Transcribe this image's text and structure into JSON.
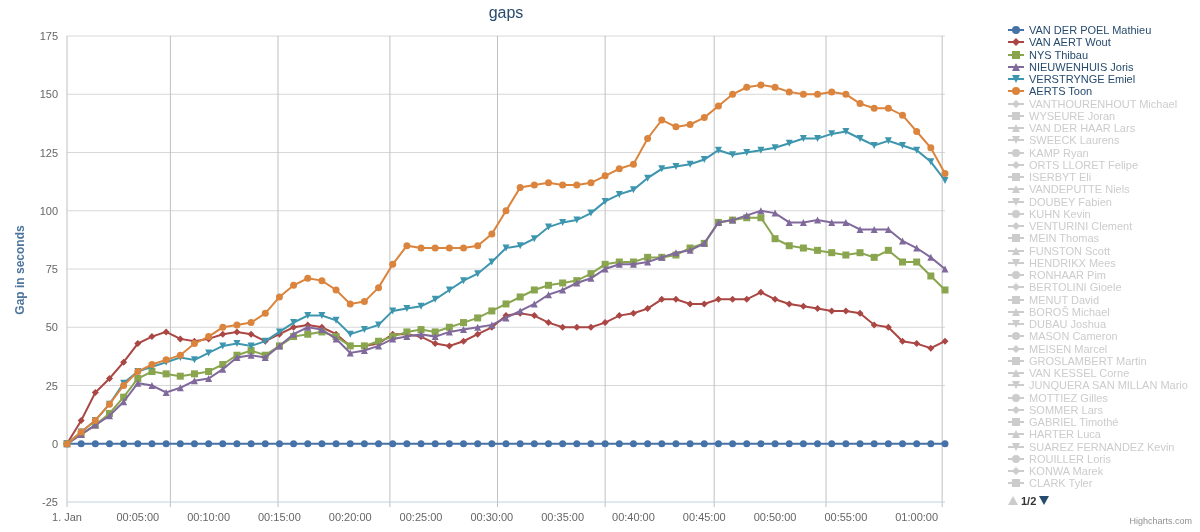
{
  "chart": {
    "chart_data": {
      "type": "line",
      "grid": true,
      "title": "gaps",
      "ylabel": "Gap in seconds",
      "x": [
        0,
        1,
        2,
        3,
        4,
        5,
        6,
        7,
        8,
        9,
        10,
        11,
        12,
        13,
        14,
        15,
        16,
        17,
        18,
        19,
        20,
        21,
        22,
        23,
        24,
        25,
        26,
        27,
        28,
        29,
        30,
        31,
        32,
        33,
        34,
        35,
        36,
        37,
        38,
        39,
        40,
        41,
        42,
        43,
        44,
        45,
        46,
        47,
        48,
        49,
        50,
        51,
        52,
        53,
        54,
        55,
        56,
        57,
        58,
        59,
        60,
        61,
        62
      ],
      "xlim": [
        0,
        62
      ],
      "ylim": [
        -25,
        175
      ],
      "yticks": [
        -25,
        0,
        25,
        50,
        75,
        100,
        125,
        150,
        175
      ],
      "xticks": [
        {
          "value": 0,
          "label": "1. Jan"
        },
        {
          "value": 5,
          "label": "00:05:00"
        },
        {
          "value": 10,
          "label": "00:10:00"
        },
        {
          "value": 15,
          "label": "00:15:00"
        },
        {
          "value": 20,
          "label": "00:20:00"
        },
        {
          "value": 25,
          "label": "00:25:00"
        },
        {
          "value": 30,
          "label": "00:30:00"
        },
        {
          "value": 35,
          "label": "00:35:00"
        },
        {
          "value": 40,
          "label": "00:40:00"
        },
        {
          "value": 45,
          "label": "00:45:00"
        },
        {
          "value": 50,
          "label": "00:50:00"
        },
        {
          "value": 55,
          "label": "00:55:00"
        },
        {
          "value": 60,
          "label": "01:00:00"
        }
      ],
      "series": [
        {
          "name": "VAN DER POEL Mathieu",
          "color": "#4572a7",
          "marker": "circle",
          "values": [
            0,
            0,
            0,
            0,
            0,
            0,
            0,
            0,
            0,
            0,
            0,
            0,
            0,
            0,
            0,
            0,
            0,
            0,
            0,
            0,
            0,
            0,
            0,
            0,
            0,
            0,
            0,
            0,
            0,
            0,
            0,
            0,
            0,
            0,
            0,
            0,
            0,
            0,
            0,
            0,
            0,
            0,
            0,
            0,
            0,
            0,
            0,
            0,
            0,
            0,
            0,
            0,
            0,
            0,
            0,
            0,
            0,
            0,
            0,
            0,
            0,
            0,
            0
          ]
        },
        {
          "name": "VAN AERT Wout",
          "color": "#aa4643",
          "marker": "diamond",
          "values": [
            0,
            10,
            22,
            28,
            35,
            43,
            46,
            48,
            45,
            44,
            45,
            47,
            48,
            47,
            44,
            47,
            50,
            51,
            50,
            47,
            42,
            42,
            43,
            47,
            47,
            46,
            43,
            42,
            44,
            47,
            50,
            55,
            56,
            55,
            52,
            50,
            50,
            50,
            52,
            55,
            56,
            58,
            62,
            62,
            60,
            60,
            62,
            62,
            62,
            65,
            62,
            60,
            59,
            58,
            57,
            57,
            56,
            51,
            50,
            44,
            43,
            41,
            44
          ]
        },
        {
          "name": "NYS Thibau",
          "color": "#89a54e",
          "marker": "square",
          "values": [
            0,
            4,
            8,
            13,
            20,
            28,
            31,
            30,
            29,
            30,
            31,
            34,
            38,
            40,
            38,
            42,
            46,
            47,
            48,
            46,
            42,
            42,
            44,
            46,
            48,
            49,
            48,
            50,
            52,
            54,
            57,
            60,
            63,
            66,
            68,
            69,
            70,
            73,
            77,
            78,
            78,
            80,
            80,
            81,
            84,
            86,
            95,
            96,
            97,
            97,
            88,
            85,
            84,
            83,
            82,
            81,
            82,
            80,
            83,
            78,
            78,
            72,
            66
          ]
        },
        {
          "name": "NIEUWENHUIS Joris",
          "color": "#80699b",
          "marker": "triangle",
          "values": [
            0,
            4,
            8,
            12,
            18,
            26,
            25,
            22,
            24,
            27,
            28,
            32,
            37,
            38,
            37,
            42,
            47,
            50,
            49,
            45,
            39,
            40,
            42,
            45,
            46,
            47,
            46,
            48,
            49,
            50,
            51,
            54,
            57,
            60,
            64,
            66,
            69,
            71,
            75,
            77,
            77,
            78,
            80,
            82,
            83,
            86,
            95,
            96,
            98,
            100,
            99,
            95,
            95,
            96,
            95,
            95,
            92,
            92,
            92,
            87,
            84,
            80,
            75
          ]
        },
        {
          "name": "VERSTRYNGE Emiel",
          "color": "#3d96ae",
          "marker": "triangle-down",
          "values": [
            0,
            5,
            10,
            17,
            26,
            31,
            33,
            35,
            37,
            36,
            39,
            42,
            43,
            42,
            44,
            48,
            52,
            55,
            55,
            53,
            47,
            49,
            51,
            57,
            58,
            59,
            62,
            66,
            70,
            73,
            78,
            84,
            85,
            88,
            93,
            95,
            96,
            99,
            104,
            107,
            109,
            114,
            118,
            119,
            120,
            122,
            126,
            124,
            125,
            126,
            127,
            129,
            131,
            131,
            133,
            134,
            131,
            128,
            130,
            128,
            126,
            121,
            113
          ]
        },
        {
          "name": "AERTS Toon",
          "color": "#db843d",
          "marker": "circle",
          "values": [
            0,
            5,
            10,
            17,
            25,
            31,
            34,
            36,
            38,
            43,
            46,
            50,
            51,
            52,
            56,
            63,
            68,
            71,
            70,
            66,
            60,
            61,
            67,
            77,
            85,
            84,
            84,
            84,
            84,
            85,
            90,
            100,
            110,
            111,
            112,
            111,
            111,
            112,
            115,
            118,
            120,
            131,
            139,
            136,
            137,
            140,
            145,
            150,
            153,
            154,
            153,
            151,
            150,
            150,
            151,
            150,
            146,
            144,
            144,
            141,
            134,
            127,
            116
          ]
        }
      ]
    }
  },
  "legend": {
    "items": [
      {
        "name": "VANTHOURENHOUT Michael",
        "kind": "diamond",
        "visible": false
      },
      {
        "name": "WYSEURE Joran",
        "kind": "square",
        "visible": false
      },
      {
        "name": "VAN DER HAAR Lars",
        "kind": "triangle",
        "visible": false
      },
      {
        "name": "SWEECK Laurens",
        "kind": "triangle-down",
        "visible": false
      },
      {
        "name": "KAMP Ryan",
        "kind": "circle",
        "visible": false
      },
      {
        "name": "ORTS LLORET Felipe",
        "kind": "diamond",
        "visible": false
      },
      {
        "name": "ISERBYT Eli",
        "kind": "square",
        "visible": false
      },
      {
        "name": "VANDEPUTTE Niels",
        "kind": "triangle",
        "visible": false
      },
      {
        "name": "DOUBEY Fabien",
        "kind": "triangle-down",
        "visible": false
      },
      {
        "name": "KUHN Kevin",
        "kind": "circle",
        "visible": false
      },
      {
        "name": "VENTURINI Clement",
        "kind": "diamond",
        "visible": false
      },
      {
        "name": "MEIN Thomas",
        "kind": "square",
        "visible": false
      },
      {
        "name": "FUNSTON Scott",
        "kind": "triangle",
        "visible": false
      },
      {
        "name": "HENDRIKX Mees",
        "kind": "triangle-down",
        "visible": false
      },
      {
        "name": "RONHAAR Pim",
        "kind": "circle",
        "visible": false
      },
      {
        "name": "BERTOLINI Gioele",
        "kind": "diamond",
        "visible": false
      },
      {
        "name": "MENUT David",
        "kind": "square",
        "visible": false
      },
      {
        "name": "BOROŠ Michael",
        "kind": "triangle",
        "visible": false
      },
      {
        "name": "DUBAU Joshua",
        "kind": "triangle-down",
        "visible": false
      },
      {
        "name": "MASON Cameron",
        "kind": "circle",
        "visible": false
      },
      {
        "name": "MEISEN Marcel",
        "kind": "diamond",
        "visible": false
      },
      {
        "name": "GROSLAMBERT Martin",
        "kind": "square",
        "visible": false
      },
      {
        "name": "VAN KESSEL Corne",
        "kind": "triangle",
        "visible": false
      },
      {
        "name": "JUNQUERA SAN MILLAN Mario",
        "kind": "triangle-down",
        "visible": false
      },
      {
        "name": "MOTTIEZ Gilles",
        "kind": "circle",
        "visible": false
      },
      {
        "name": "SOMMER Lars",
        "kind": "diamond",
        "visible": false
      },
      {
        "name": "GABRIEL Timothé",
        "kind": "square",
        "visible": false
      },
      {
        "name": "HARTER Luca",
        "kind": "triangle",
        "visible": false
      },
      {
        "name": "SUAREZ FERNANDEZ Kevin",
        "kind": "triangle-down",
        "visible": false
      },
      {
        "name": "ROUILLER Loris",
        "kind": "circle",
        "visible": false
      },
      {
        "name": "KONWA Marek",
        "kind": "diamond",
        "visible": false
      },
      {
        "name": "CLARK Tyler",
        "kind": "square",
        "visible": false
      }
    ],
    "pager": {
      "text": "1/2",
      "up_disabled": true,
      "down_disabled": false
    }
  },
  "credits": "Highcharts.com"
}
